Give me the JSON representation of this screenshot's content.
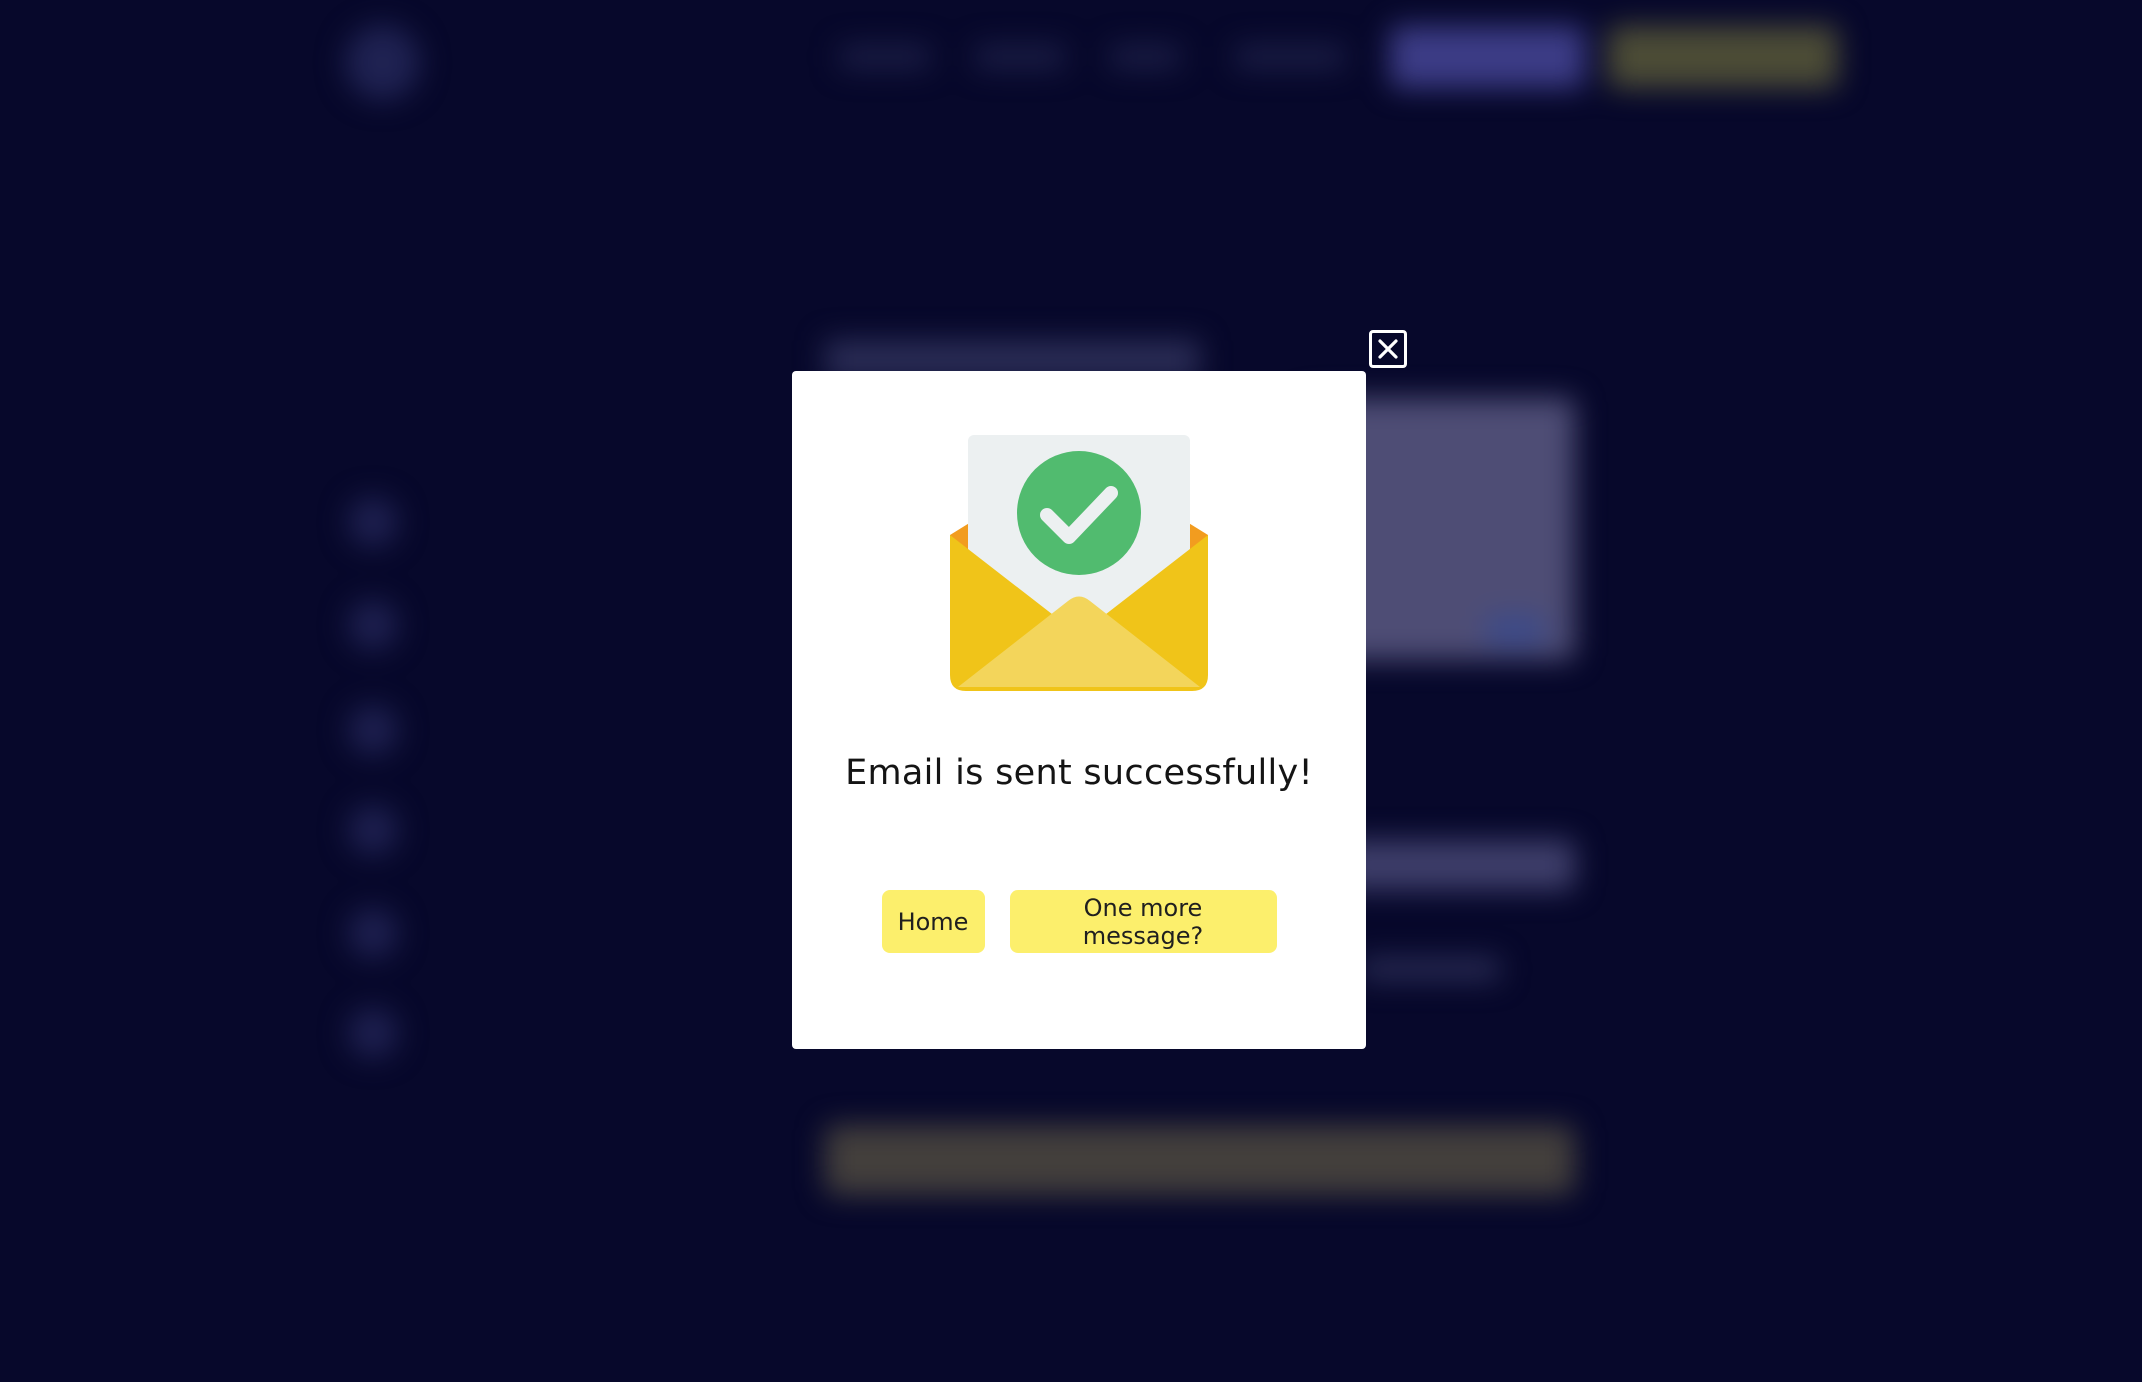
{
  "modal": {
    "message": "Email is sent successfully!",
    "buttons": {
      "home_label": "Home",
      "more_label": "One more message?"
    },
    "close_icon": "close-x-icon",
    "illustration_icon": "envelope-check-icon"
  },
  "colors": {
    "page_background": "#07082b",
    "modal_background": "#ffffff",
    "button_background": "#fcef6c",
    "check_green": "#51bb6f",
    "envelope_yellow": "#f0c419",
    "envelope_flap": "#f3d55b",
    "envelope_inner": "#f29c1f",
    "letter_paper": "#ecf0f1"
  }
}
